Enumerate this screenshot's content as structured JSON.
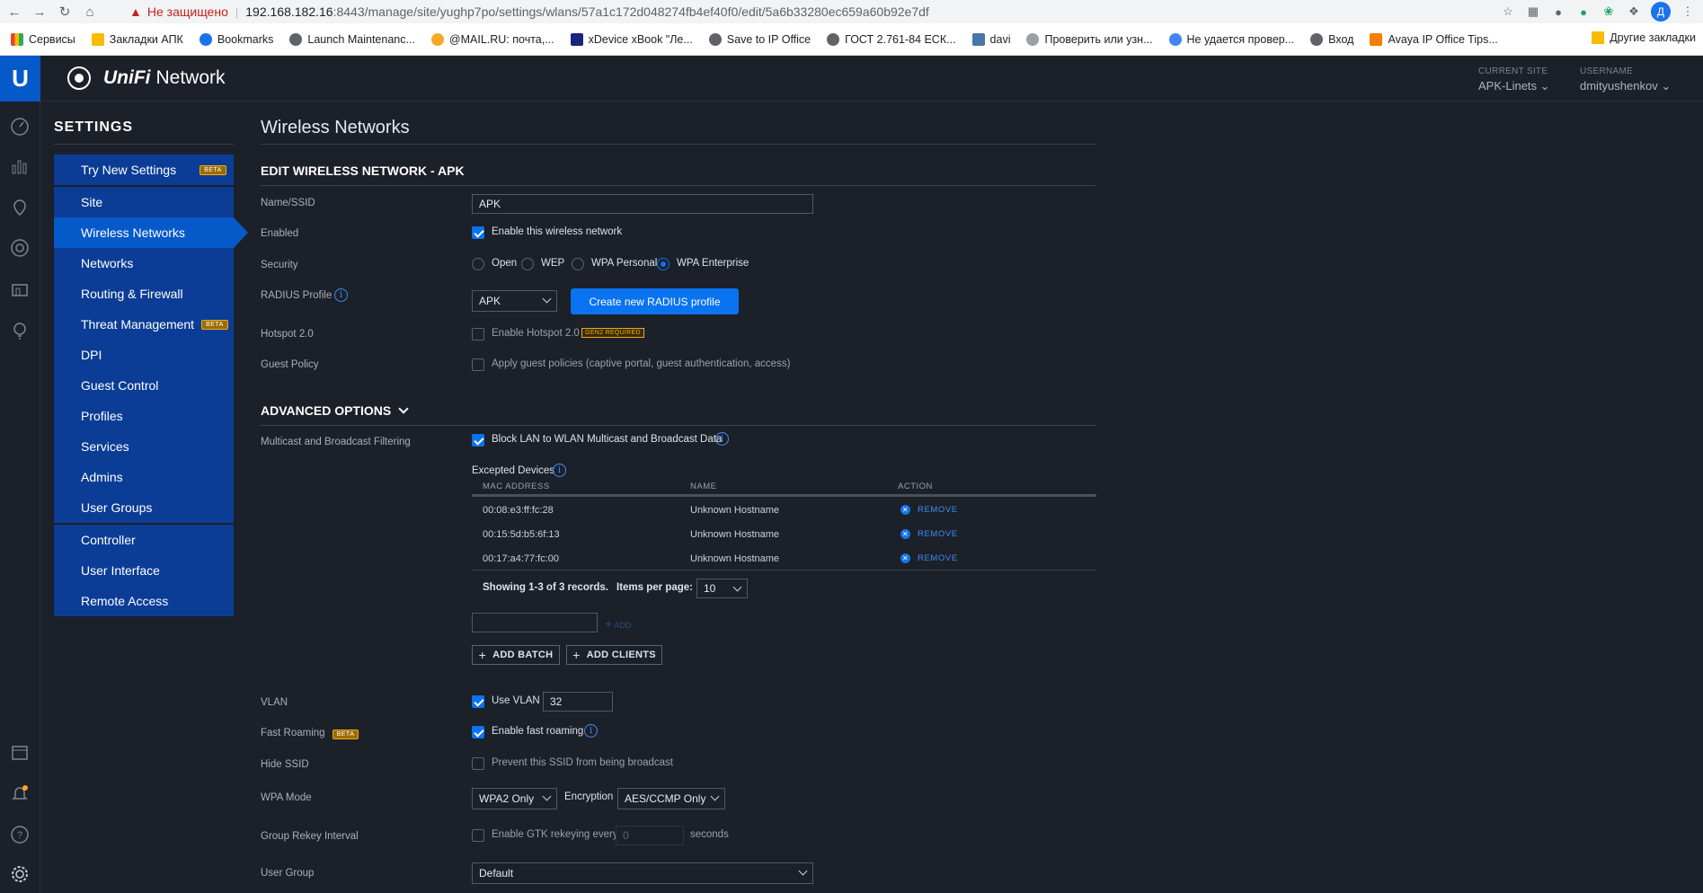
{
  "browser": {
    "security_label": "Не защищено",
    "url_host": "192.168.182.16",
    "url_rest": ":8443/manage/site/yughp7po/settings/wlans/57a1c172d048274fb4ef40f0/edit/5a6b33280ec659a60b92e7df",
    "avatar_letter": "Д"
  },
  "bookmarks": {
    "items": [
      "Сервисы",
      "Закладки АПК",
      "Bookmarks",
      "Launch Maintenanc...",
      "@MAIL.RU: почта,...",
      "xDevice xBook \"Ле...",
      "Save to IP Office",
      "ГОСТ 2.761-84 ЕСК...",
      "davi",
      "Проверить или узн...",
      "Не удается провер...",
      "Вход",
      "Avaya IP Office Tips..."
    ],
    "other": "Другие закладки"
  },
  "header": {
    "brand_uni": "UniFi",
    "brand_network": "Network",
    "current_site_label": "CURRENT SITE",
    "current_site_value": "APK-Linets",
    "username_label": "USERNAME",
    "username_value": "dmityushenkov"
  },
  "settings": {
    "title": "SETTINGS",
    "try_new": "Try New Settings",
    "beta": "BETA",
    "items": [
      "Site",
      "Wireless Networks",
      "Networks",
      "Routing & Firewall",
      "Threat Management",
      "DPI",
      "Guest Control",
      "Profiles",
      "Services",
      "Admins",
      "User Groups"
    ],
    "items2": [
      "Controller",
      "User Interface",
      "Remote Access"
    ]
  },
  "main": {
    "page_title": "Wireless Networks",
    "edit_heading": "EDIT WIRELESS NETWORK - APK",
    "name_label": "Name/SSID",
    "name_value": "APK",
    "enabled_label": "Enabled",
    "enabled_text": "Enable this wireless network",
    "security_label": "Security",
    "security_options": [
      "Open",
      "WEP",
      "WPA Personal",
      "WPA Enterprise"
    ],
    "radius_label": "RADIUS Profile",
    "radius_value": "APK",
    "radius_create": "Create new RADIUS profile",
    "hotspot_label": "Hotspot 2.0",
    "hotspot_text": "Enable Hotspot 2.0",
    "gen2_tag": "GEN2 REQUIRED",
    "guest_label": "Guest Policy",
    "guest_text": "Apply guest policies (captive portal, guest authentication, access)",
    "advanced_heading": "ADVANCED OPTIONS",
    "multicast_label": "Multicast and Broadcast Filtering",
    "multicast_text": "Block LAN to WLAN Multicast and Broadcast Data",
    "excepted_label": "Excepted Devices",
    "table_headers": [
      "MAC ADDRESS",
      "NAME",
      "ACTION"
    ],
    "rows": [
      {
        "mac": "00:08:e3:ff:fc:28",
        "name": "Unknown Hostname",
        "action": "REMOVE"
      },
      {
        "mac": "00:15:5d:b5:6f:13",
        "name": "Unknown Hostname",
        "action": "REMOVE"
      },
      {
        "mac": "00:17:a4:77:fc:00",
        "name": "Unknown Hostname",
        "action": "REMOVE"
      }
    ],
    "showing": "Showing 1-3 of 3 records.",
    "items_per_page_label": "Items per page:",
    "items_per_page": "10",
    "add_label": "ADD",
    "add_batch": "ADD BATCH",
    "add_clients": "ADD CLIENTS",
    "vlan_label": "VLAN",
    "vlan_text": "Use VLAN",
    "vlan_value": "32",
    "fast_roaming_label": "Fast Roaming",
    "fast_roaming_text": "Enable fast roaming",
    "hide_ssid_label": "Hide SSID",
    "hide_ssid_text": "Prevent this SSID from being broadcast",
    "wpa_mode_label": "WPA Mode",
    "wpa_mode_value": "WPA2 Only",
    "encryption_label": "Encryption",
    "encryption_value": "AES/CCMP Only",
    "rekey_label": "Group Rekey Interval",
    "rekey_text": "Enable GTK rekeying every",
    "rekey_value": "0",
    "rekey_unit": "seconds",
    "user_group_label": "User Group",
    "user_group_value": "Default"
  },
  "colors": {
    "accent": "#0a73f0",
    "sidebar": "#0b3d96",
    "active": "#0559c9",
    "background": "#1b2029"
  }
}
